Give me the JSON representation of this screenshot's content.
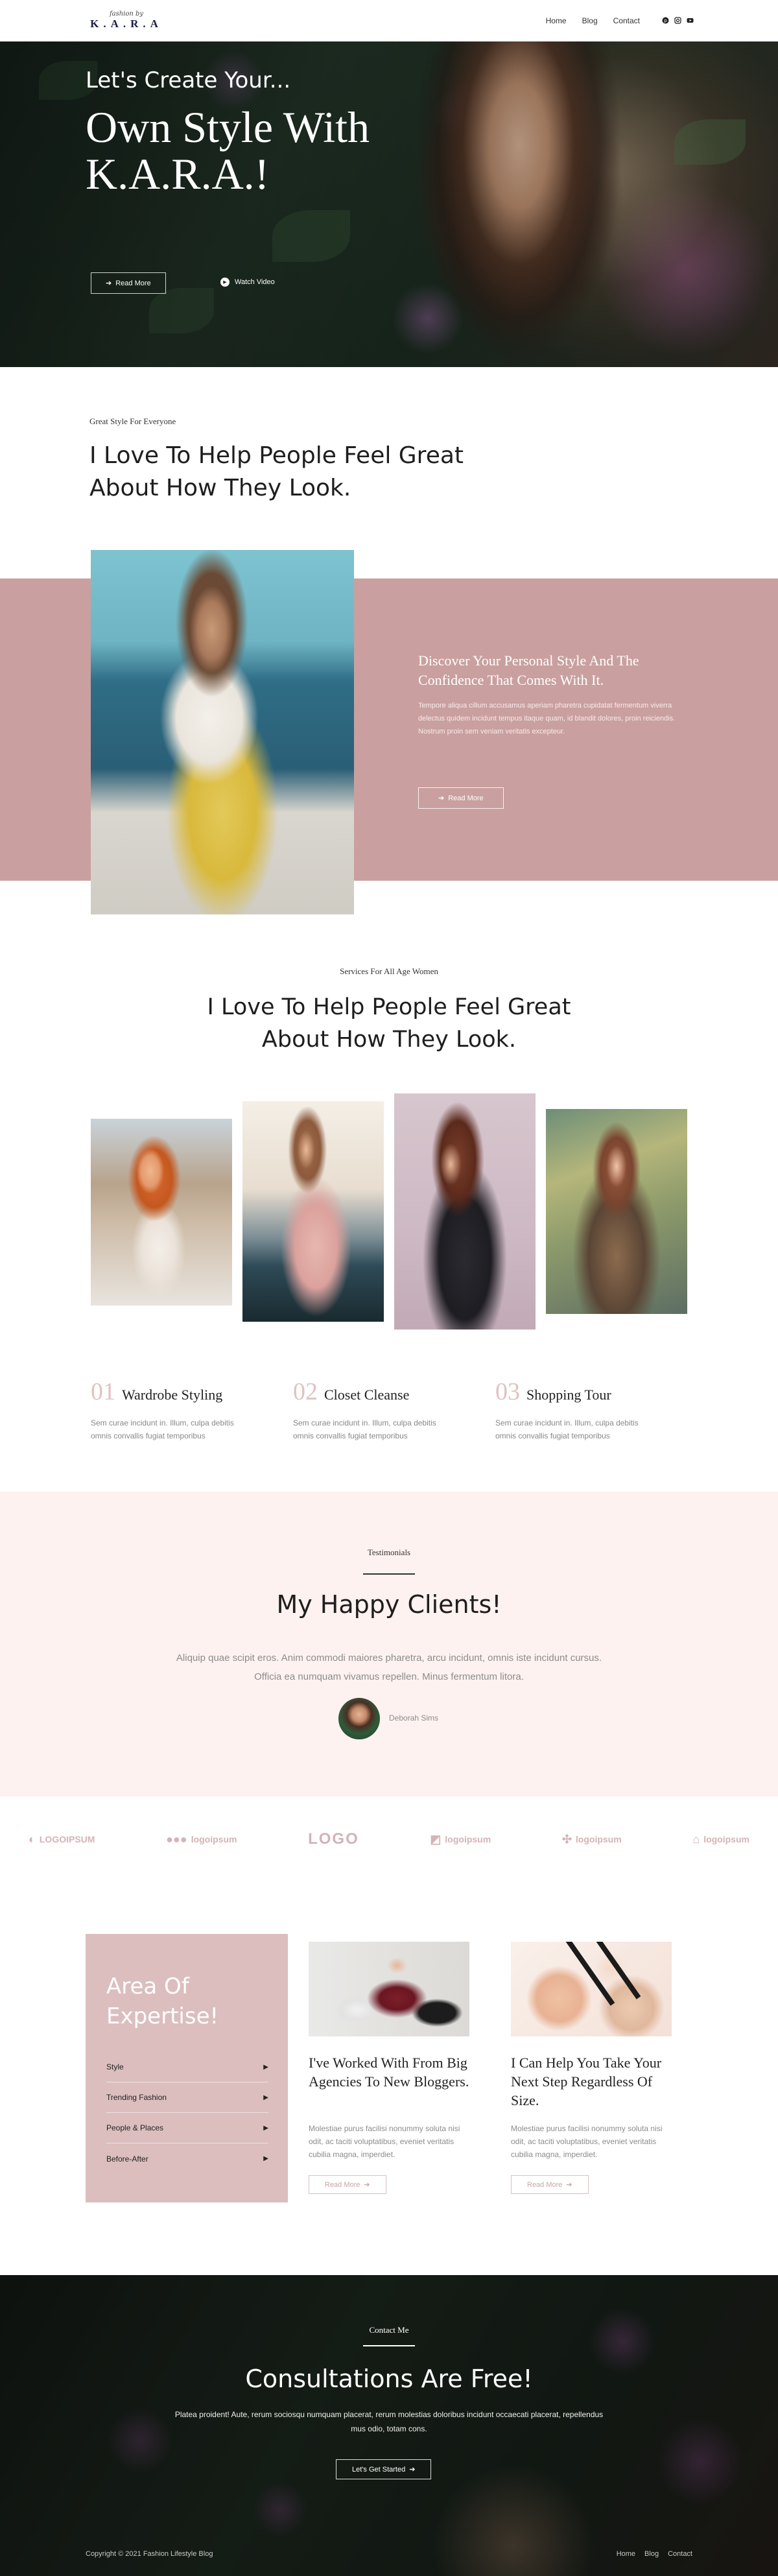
{
  "nav": {
    "logo_script": "fashion by",
    "logo_mark": "K.A.R.A",
    "links": [
      "Home",
      "Blog",
      "Contact"
    ],
    "social_icons": [
      "pinterest-icon",
      "instagram-icon",
      "youtube-icon"
    ]
  },
  "hero": {
    "eyebrow": "Let's Create Your...",
    "title": "Own Style With K.A.R.A.!",
    "read_more": "Read More",
    "watch_video": "Watch Video"
  },
  "intro": {
    "eyebrow": "Great Style For Everyone",
    "title": "I Love To Help People Feel Great About How They Look."
  },
  "discover": {
    "heading": "Discover Your Personal Style And The Confidence That Comes With It.",
    "body": "Tempore aliqua cillum accusamus aperiam pharetra cupidatat fermentum viverra delectus quidem incidunt tempus itaque quam, id blandit dolores, proin reiciendis. Nostrum proin sem veniam veritatis excepteur.",
    "button": "Read More"
  },
  "services": {
    "eyebrow": "Services For All Age Women",
    "title": "I Love To Help People Feel Great About How They Look.",
    "items": [
      {
        "num": "01",
        "name": "Wardrobe Styling",
        "desc": "Sem curae incidunt in. Illum, culpa debitis omnis convallis fugiat temporibus"
      },
      {
        "num": "02",
        "name": "Closet Cleanse",
        "desc": "Sem curae incidunt in. Illum, culpa debitis omnis convallis fugiat temporibus"
      },
      {
        "num": "03",
        "name": "Shopping Tour",
        "desc": "Sem curae incidunt in. Illum, culpa debitis omnis convallis fugiat temporibus"
      }
    ]
  },
  "testimonials": {
    "eyebrow": "Testimonials",
    "title": "My Happy Clients!",
    "quote": "Aliquip quae scipit eros. Anim commodi maiores pharetra, arcu incidunt, omnis iste incidunt cursus. Officia ea numquam vivamus repellen. Minus fermentum litora.",
    "name": "Deborah Sims"
  },
  "logos": [
    "LOGOIPSUM",
    "logoipsum",
    "LOGO",
    "logoipsum",
    "logoipsum",
    "logoipsum"
  ],
  "expertise": {
    "title": "Area Of Expertise!",
    "items": [
      "Style",
      "Trending Fashion",
      "People & Places",
      "Before-After"
    ]
  },
  "cards": [
    {
      "title": "I've Worked With From Big Agencies To New Bloggers.",
      "desc": "Molestiae purus facilisi nonummy soluta nisi odit, ac taciti voluptatibus, eveniet veritatis cubilia magna, imperdiet.",
      "button": "Read More"
    },
    {
      "title": "I Can Help You Take Your Next Step Regardless Of Size.",
      "desc": "Molestiae purus facilisi nonummy soluta nisi odit, ac taciti voluptatibus, eveniet veritatis cubilia magna, imperdiet.",
      "button": "Read More"
    }
  ],
  "contact": {
    "eyebrow": "Contact Me",
    "title": "Consultations Are Free!",
    "body": "Platea proident! Aute, rerum sociosqu numquam placerat, rerum molestias doloribus incidunt occaecati placerat, repellendus mus odio, totam cons.",
    "button": "Let's Get Started"
  },
  "footer": {
    "copyright": "Copyright © 2021 Fashion Lifestyle Blog",
    "links": [
      "Home",
      "Blog",
      "Contact"
    ]
  },
  "colors": {
    "accent_pink": "#c9a09f",
    "soft_pink": "#dcbebe",
    "blush_bg": "#fdf2ef"
  }
}
